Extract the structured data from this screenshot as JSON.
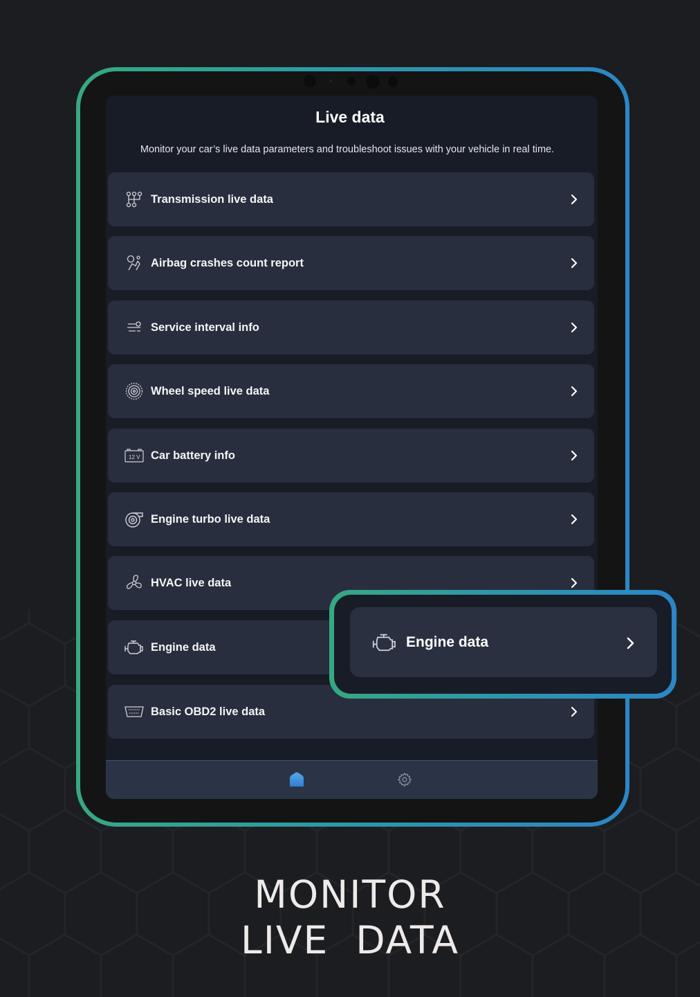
{
  "screen": {
    "title": "Live data",
    "subtitle": "Monitor your car’s live data parameters and troubleshoot issues with your vehicle in real time."
  },
  "items": [
    {
      "label": "Transmission live data",
      "icon": "transmission-icon"
    },
    {
      "label": "Airbag crashes count report",
      "icon": "airbag-icon"
    },
    {
      "label": "Service interval info",
      "icon": "service-interval-icon"
    },
    {
      "label": "Wheel speed live data",
      "icon": "wheel-icon"
    },
    {
      "label": "Car battery info",
      "icon": "battery-icon",
      "icon_text": "12 V"
    },
    {
      "label": "Engine turbo live data",
      "icon": "turbo-icon"
    },
    {
      "label": "HVAC live data",
      "icon": "fan-icon"
    },
    {
      "label": "Engine data",
      "icon": "engine-icon"
    },
    {
      "label": "Basic OBD2 live data",
      "icon": "obd2-connector-icon"
    }
  ],
  "bottom_nav": {
    "items": [
      {
        "name": "home",
        "icon": "home-icon",
        "active": true
      },
      {
        "name": "settings",
        "icon": "gear-icon",
        "active": false
      }
    ]
  },
  "callout": {
    "label": "Engine data",
    "icon": "engine-icon"
  },
  "tagline": {
    "line1": "MONITOR",
    "line2": "LIVE  DATA"
  },
  "colors": {
    "accent_green": "#36a882",
    "accent_blue": "#2c86c6",
    "active_nav": "#3d8fdb",
    "card": "#282e3d",
    "screen": "#181c26"
  }
}
